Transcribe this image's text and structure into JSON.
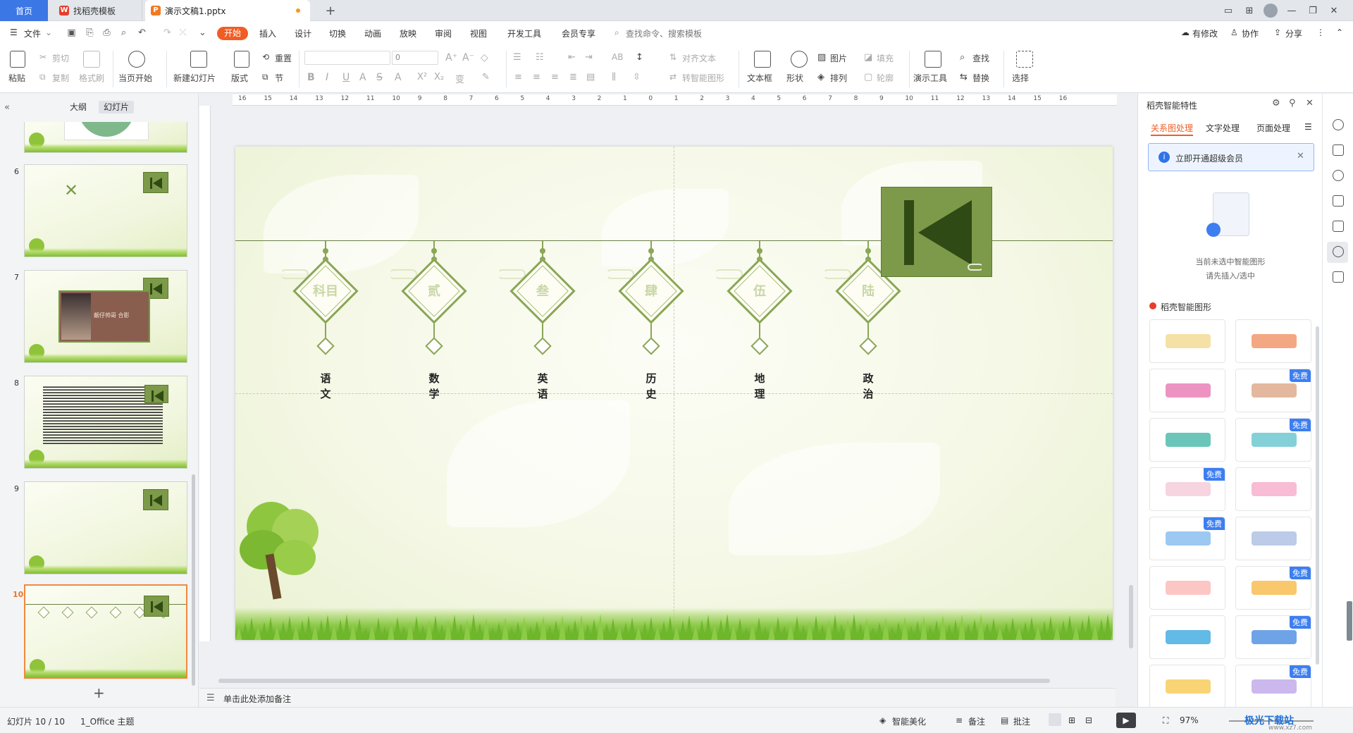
{
  "tabs": {
    "home": "首页",
    "template": "找稻壳模板",
    "doc": "演示文稿1.pptx",
    "new_tab": "+"
  },
  "menu": {
    "file": "文件",
    "items": [
      "开始",
      "插入",
      "设计",
      "切换",
      "动画",
      "放映",
      "审阅",
      "视图",
      "开发工具",
      "会员专享"
    ],
    "search_placeholder": "查找命令、搜索模板",
    "has_changes": "有修改",
    "collaborate": "协作",
    "share": "分享"
  },
  "toolbar": {
    "paste": "粘贴",
    "cut": "剪切",
    "copy": "复制",
    "format_painter": "格式刷",
    "start_from_first": "当页开始",
    "new_slide": "新建幻灯片",
    "layout": "版式",
    "reset": "重置",
    "section": "节",
    "font_size_value": "0",
    "align_text": "对齐文本",
    "to_smartart": "转智能图形",
    "textbox": "文本框",
    "shape": "形状",
    "picture": "图片",
    "arrange": "排列",
    "fill": "填充",
    "outline": "轮廓",
    "present_tools": "演示工具",
    "find": "查找",
    "replace": "替换",
    "select": "选择"
  },
  "left_panel": {
    "tab_outline": "大纲",
    "tab_slides": "幻灯片",
    "slide_numbers": [
      "6",
      "7",
      "8",
      "9",
      "10"
    ],
    "slide7_caption": "靓仔帅哥 合影",
    "add_slide": "+"
  },
  "ruler_labels": [
    "16",
    "15",
    "14",
    "13",
    "12",
    "11",
    "10",
    "9",
    "8",
    "7",
    "6",
    "5",
    "4",
    "3",
    "2",
    "1",
    "0",
    "1",
    "2",
    "3",
    "4",
    "5",
    "6",
    "7",
    "8",
    "9",
    "10",
    "11",
    "12",
    "13",
    "14",
    "15",
    "16"
  ],
  "slide": {
    "ornaments": [
      {
        "label": "科目",
        "subject": "语\n文"
      },
      {
        "label": "贰",
        "subject": "数\n学"
      },
      {
        "label": "叁",
        "subject": "英\n语"
      },
      {
        "label": "肆",
        "subject": "历\n史"
      },
      {
        "label": "伍",
        "subject": "地\n理"
      },
      {
        "label": "陆",
        "subject": "政\n治"
      }
    ]
  },
  "notes_placeholder": "单击此处添加备注",
  "right_panel": {
    "title": "稻壳智能特性",
    "tabs": [
      "关系图处理",
      "文字处理",
      "页面处理"
    ],
    "promo": "立即开通超级会员",
    "empty_line1": "当前未选中智能图形",
    "empty_line2": "请先插入/选中",
    "section": "稻壳智能图形",
    "free_label": "免费"
  },
  "status": {
    "slide_count": "幻灯片 10 / 10",
    "theme": "1_Office 主题",
    "beautify": "智能美化",
    "notes": "备注",
    "comments": "批注",
    "zoom": "97%"
  },
  "watermark": "极光下载站",
  "watermark_url": "www.xz7.com",
  "colors": {
    "accent": "#f05d24",
    "tab_blue": "#3c77e6",
    "ornament_green": "#8aa656",
    "play_green": "#7c9a49"
  }
}
